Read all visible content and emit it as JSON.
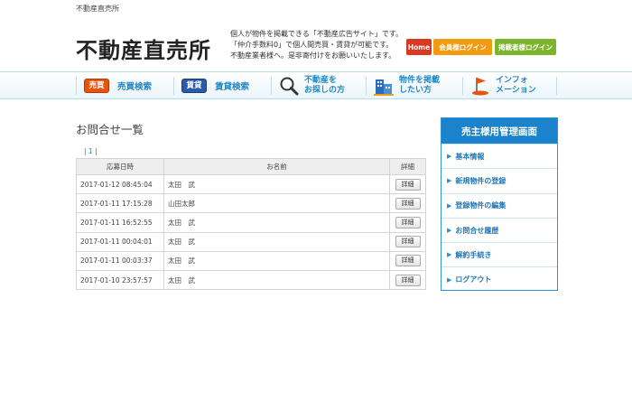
{
  "site": {
    "topline": "不動産直売所",
    "logo": "不動産直売所",
    "desc_lines": [
      "個人が物件を掲載できる「不動産広告サイト」です。",
      "「仲介手数料0」で個人間売買・賃貸が可能です。",
      "不動産業者様へ。是非寄付けをお願いいたします。"
    ]
  },
  "header_buttons": {
    "home": "Home",
    "member_login": "会員様ログイン",
    "poster_login": "掲載者様ログイン"
  },
  "nav": {
    "sale_tag": "売買",
    "sale_label": "売買検索",
    "rent_tag": "賃貸",
    "rent_label": "賃貸検索",
    "find_line1": "不動産を",
    "find_line2": "お探しの方",
    "post_line1": "物件を掲載",
    "post_line2": "したい方",
    "info_line1": "インフォ",
    "info_line2": "メーション"
  },
  "main": {
    "title": "お問合せ一覧",
    "pager_open": "|",
    "pager_page": "1",
    "pager_close": "|",
    "table": {
      "headers": [
        "応募日時",
        "お名前",
        "詳細"
      ],
      "rows": [
        {
          "date": "2017-01-12 08:45:04",
          "name": "太田　武",
          "detail": "詳細"
        },
        {
          "date": "2017-01-11 17:15:28",
          "name": "山田太郎",
          "detail": "詳細"
        },
        {
          "date": "2017-01-11 16:52:55",
          "name": "太田　武",
          "detail": "詳細"
        },
        {
          "date": "2017-01-11 00:04:01",
          "name": "太田　武",
          "detail": "詳細"
        },
        {
          "date": "2017-01-11 00:03:37",
          "name": "太田　武",
          "detail": "詳細"
        },
        {
          "date": "2017-01-10 23:57:57",
          "name": "太田　武",
          "detail": "詳細"
        }
      ]
    }
  },
  "sidebar": {
    "title": "売主様用管理画面",
    "items": [
      "基本情報",
      "新規物件の登録",
      "登録物件の編集",
      "お問合せ履歴",
      "解約手続き",
      "ログアウト"
    ]
  },
  "colors": {
    "accent_blue": "#1b82cc",
    "home_red": "#d9391e",
    "member_orange": "#f29b12",
    "poster_green": "#7cb52d"
  }
}
